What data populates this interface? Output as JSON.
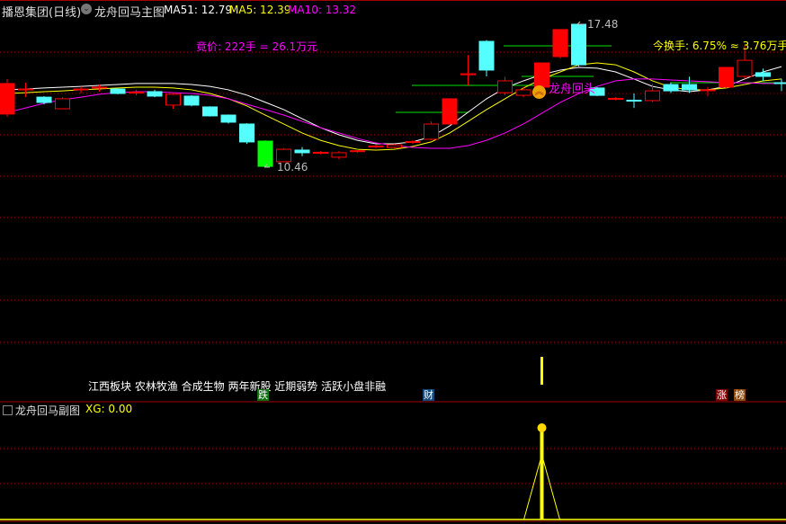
{
  "header": {
    "stock": "播恩集团(日线)",
    "indicator": "龙舟回马主图",
    "ma51": "MA51: 12.79",
    "ma5": "MA5: 12.39",
    "ma10": "MA10: 13.32"
  },
  "auction": "竟价: 222手 = 26.1万元",
  "turnover": "今换手: 6.75% ≈ 3.76万手",
  "annotations": {
    "high": "17.48",
    "low": "10.46",
    "signal": "龙舟回头"
  },
  "concepts": "江西板块 农林牧渔 合成生物 两年新股 近期弱势 活跃小盘非融",
  "tags": {
    "fall": "跌",
    "finance": "财",
    "rise": "涨",
    "rank": "榜"
  },
  "sub": {
    "title": "龙舟回马副图",
    "xg": "XG: 0.00"
  },
  "colors": {
    "up": "#ff0000",
    "down": "#54ffff",
    "limit_down": "#00ff00",
    "ma51": "#ffffff",
    "ma5": "#ffff00",
    "ma10": "#ff00ff",
    "grid": "#a00000"
  },
  "chart_data": {
    "type": "candlestick",
    "price_range": [
      10.46,
      17.48
    ],
    "candles": [
      {
        "o": 13.07,
        "c": 14.57,
        "h": 14.79,
        "l": 12.93,
        "s": "limit_up"
      },
      {
        "o": 14.26,
        "c": 14.3,
        "h": 14.61,
        "l": 13.9,
        "s": "up"
      },
      {
        "o": 13.9,
        "c": 13.64,
        "h": 13.95,
        "l": 13.55,
        "s": "down"
      },
      {
        "o": 13.33,
        "c": 13.82,
        "h": 13.9,
        "l": 13.3,
        "s": "up"
      },
      {
        "o": 14.26,
        "c": 14.3,
        "h": 14.43,
        "l": 14.08,
        "s": "up"
      },
      {
        "o": 14.35,
        "c": 14.39,
        "h": 14.52,
        "l": 14.17,
        "s": "up"
      },
      {
        "o": 14.3,
        "c": 14.08,
        "h": 14.35,
        "l": 14.04,
        "s": "down"
      },
      {
        "o": 14.12,
        "c": 14.15,
        "h": 14.26,
        "l": 13.99,
        "s": "up"
      },
      {
        "o": 14.17,
        "c": 13.95,
        "h": 14.26,
        "l": 13.9,
        "s": "down"
      },
      {
        "o": 13.51,
        "c": 14.04,
        "h": 14.12,
        "l": 13.33,
        "s": "up"
      },
      {
        "o": 13.95,
        "c": 13.51,
        "h": 14.0,
        "l": 13.45,
        "s": "down"
      },
      {
        "o": 13.42,
        "c": 12.98,
        "h": 13.45,
        "l": 12.95,
        "s": "down"
      },
      {
        "o": 13.02,
        "c": 12.67,
        "h": 13.05,
        "l": 12.6,
        "s": "down"
      },
      {
        "o": 12.58,
        "c": 11.7,
        "h": 12.62,
        "l": 11.6,
        "s": "down"
      },
      {
        "o": 11.74,
        "c": 10.5,
        "h": 11.78,
        "l": 10.46,
        "s": "limit_down"
      },
      {
        "o": 10.73,
        "c": 11.34,
        "h": 11.4,
        "l": 10.7,
        "s": "up"
      },
      {
        "o": 11.3,
        "c": 11.17,
        "h": 11.45,
        "l": 11.0,
        "s": "down"
      },
      {
        "o": 11.17,
        "c": 11.19,
        "h": 11.25,
        "l": 11.1,
        "s": "up"
      },
      {
        "o": 10.95,
        "c": 11.17,
        "h": 11.25,
        "l": 10.85,
        "s": "up"
      },
      {
        "o": 11.25,
        "c": 11.27,
        "h": 11.34,
        "l": 11.17,
        "s": "up"
      },
      {
        "o": 11.48,
        "c": 11.5,
        "h": 11.56,
        "l": 11.4,
        "s": "up"
      },
      {
        "o": 11.43,
        "c": 11.56,
        "h": 11.6,
        "l": 11.4,
        "s": "up"
      },
      {
        "o": 11.7,
        "c": 11.72,
        "h": 11.78,
        "l": 11.6,
        "s": "up"
      },
      {
        "o": 11.83,
        "c": 12.58,
        "h": 12.7,
        "l": 11.78,
        "s": "up"
      },
      {
        "o": 12.58,
        "c": 13.82,
        "h": 13.82,
        "l": 12.58,
        "s": "limit_up"
      },
      {
        "o": 15.0,
        "c": 15.05,
        "h": 15.97,
        "l": 14.48,
        "s": "up"
      },
      {
        "o": 16.64,
        "c": 15.23,
        "h": 16.7,
        "l": 14.92,
        "s": "down"
      },
      {
        "o": 14.12,
        "c": 14.7,
        "h": 14.9,
        "l": 14.0,
        "s": "up"
      },
      {
        "o": 13.99,
        "c": 14.26,
        "h": 14.4,
        "l": 13.9,
        "s": "up"
      },
      {
        "o": 14.39,
        "c": 15.58,
        "h": 15.58,
        "l": 14.3,
        "s": "limit_up"
      },
      {
        "o": 15.89,
        "c": 17.22,
        "h": 17.22,
        "l": 15.8,
        "s": "limit_up"
      },
      {
        "o": 17.48,
        "c": 15.49,
        "h": 17.48,
        "l": 15.4,
        "s": "down"
      },
      {
        "o": 14.35,
        "c": 13.99,
        "h": 14.4,
        "l": 13.95,
        "s": "down"
      },
      {
        "o": 13.82,
        "c": 13.84,
        "h": 13.9,
        "l": 13.75,
        "s": "up"
      },
      {
        "o": 13.75,
        "c": 13.73,
        "h": 14.08,
        "l": 13.37,
        "s": "down"
      },
      {
        "o": 13.73,
        "c": 14.21,
        "h": 14.55,
        "l": 13.65,
        "s": "up"
      },
      {
        "o": 14.52,
        "c": 14.21,
        "h": 14.6,
        "l": 14.1,
        "s": "down"
      },
      {
        "o": 14.52,
        "c": 14.26,
        "h": 14.9,
        "l": 14.1,
        "s": "down"
      },
      {
        "o": 14.24,
        "c": 14.26,
        "h": 14.4,
        "l": 13.95,
        "s": "up"
      },
      {
        "o": 14.39,
        "c": 15.36,
        "h": 15.36,
        "l": 14.3,
        "s": "limit_up"
      },
      {
        "o": 14.92,
        "c": 15.71,
        "h": 16.46,
        "l": 14.8,
        "s": "up"
      },
      {
        "o": 15.1,
        "c": 14.92,
        "h": 15.3,
        "l": 14.7,
        "s": "down"
      },
      {
        "o": 14.61,
        "c": 14.6,
        "h": 14.8,
        "l": 14.2,
        "s": "down"
      }
    ],
    "ma51": [
      14.26,
      14.3,
      14.35,
      14.39,
      14.43,
      14.48,
      14.52,
      14.57,
      14.57,
      14.57,
      14.52,
      14.43,
      14.26,
      14.0,
      13.65,
      13.29,
      12.84,
      12.4,
      12.05,
      11.78,
      11.61,
      11.61,
      11.7,
      11.96,
      12.49,
      13.16,
      13.82,
      14.35,
      14.7,
      15.01,
      15.23,
      15.36,
      15.32,
      15.14,
      14.79,
      14.43,
      14.26,
      14.17,
      14.26,
      14.43,
      14.79,
      15.14,
      15.4
    ],
    "ma5": [
      14.08,
      14.12,
      14.17,
      14.21,
      14.26,
      14.3,
      14.35,
      14.39,
      14.39,
      14.35,
      14.26,
      14.08,
      13.82,
      13.47,
      13.02,
      12.58,
      12.14,
      11.78,
      11.52,
      11.34,
      11.3,
      11.34,
      11.48,
      11.7,
      12.14,
      12.71,
      13.29,
      13.82,
      14.35,
      14.79,
      15.14,
      15.49,
      15.58,
      15.49,
      15.14,
      14.7,
      14.39,
      14.26,
      14.26,
      14.35,
      14.52,
      14.7,
      14.79
    ],
    "ma10": [
      13.15,
      13.37,
      13.6,
      13.77,
      13.9,
      14.04,
      14.12,
      14.17,
      14.17,
      14.12,
      14.08,
      13.99,
      13.82,
      13.55,
      13.29,
      13.02,
      12.71,
      12.4,
      12.14,
      11.87,
      11.65,
      11.52,
      11.43,
      11.39,
      11.39,
      11.52,
      11.78,
      12.14,
      12.58,
      13.11,
      13.64,
      14.08,
      14.43,
      14.7,
      14.79,
      14.79,
      14.74,
      14.7,
      14.66,
      14.61,
      14.61,
      14.57,
      14.57
    ],
    "signal_index": 29,
    "xg_peak_index": 29
  }
}
